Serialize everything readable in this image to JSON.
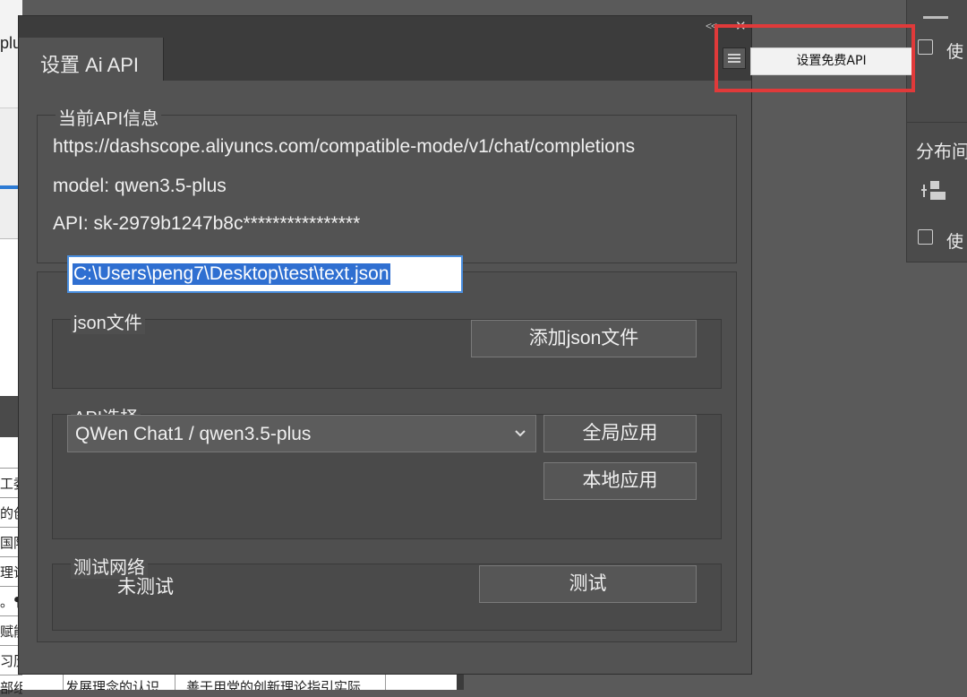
{
  "background": {
    "left_top_text": "plu",
    "left_row_fragments": [
      "工委",
      "的创",
      "国际",
      "理论",
      "。¶",
      "赋能",
      "习历",
      "部组"
    ],
    "bottom_row_cells": [
      "发展理念的认识",
      "善于用党的创新理论指引实际"
    ],
    "right_panel": {
      "checkbox_label_1": "使",
      "section_label": "分布间",
      "checkbox_label_2": "使"
    }
  },
  "dialog": {
    "collapse_icon": "<<",
    "close_icon": "✕",
    "tab_title": "设置 Ai API",
    "menu_item": "设置免费API",
    "current_info": {
      "title": "当前API信息",
      "url": "https://dashscope.aliyuncs.com/compatible-mode/v1/chat/completions",
      "model": "model: qwen3.5-plus",
      "api": "API: sk-2979b1247b8c****************"
    },
    "json_section": {
      "title": "json文件",
      "path_value": "C:\\Users\\peng7\\Desktop\\test\\text.json",
      "add_button": "添加json文件"
    },
    "api_section": {
      "title": "API选择",
      "selected": "QWen Chat1 / qwen3.5-plus",
      "global_button": "全局应用",
      "local_button": "本地应用"
    },
    "network_section": {
      "title": "测试网络",
      "status": "未测试",
      "test_button": "测试"
    }
  }
}
